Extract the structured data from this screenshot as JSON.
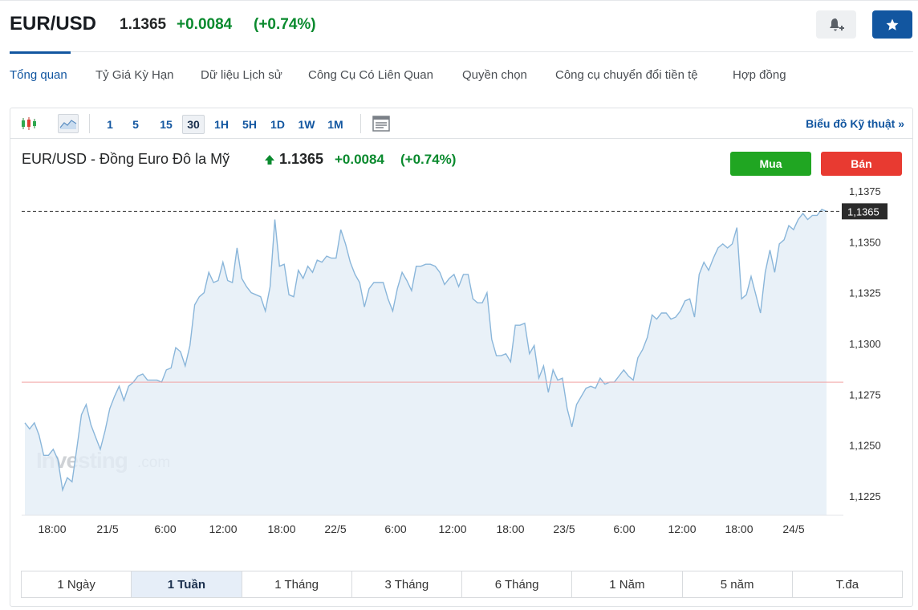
{
  "header": {
    "symbol": "EUR/USD",
    "price": "1.1365",
    "change": "+0.0084",
    "change_pct": "(+0.74%)"
  },
  "tabs": [
    {
      "label": "Tổng quan",
      "active": true
    },
    {
      "label": "Tỷ Giá Kỳ Hạn"
    },
    {
      "label": "Dữ liệu Lịch sử"
    },
    {
      "label": "Công Cụ Có Liên Quan"
    },
    {
      "label": "Quyền chọn"
    },
    {
      "label": "Công cụ chuyển đổi tiền tệ"
    },
    {
      "label": "Hợp đồng"
    }
  ],
  "toolbar": {
    "chart_types": [
      "candlestick-icon",
      "area-chart-icon"
    ],
    "intervals": [
      "1",
      "5",
      "15",
      "30",
      "1H",
      "5H",
      "1D",
      "1W",
      "1M"
    ],
    "selected_interval": "30",
    "technical_link": "Biểu đồ Kỹ thuật »"
  },
  "chart_header": {
    "title": "EUR/USD - Đồng Euro Đô la Mỹ",
    "price": "1.1365",
    "change": "+0.0084",
    "change_pct": "(+0.74%)",
    "buy_label": "Mua",
    "sell_label": "Bán"
  },
  "ranges": [
    "1 Ngày",
    "1 Tuần",
    "1 Tháng",
    "3 Tháng",
    "6 Tháng",
    "1 Năm",
    "5 năm",
    "T.đa"
  ],
  "selected_range": "1 Tuần",
  "watermark": "Investing.com",
  "colors": {
    "accent": "#1256a0",
    "positive": "#0a8a2e",
    "buy": "#20a622",
    "sell": "#e83a31",
    "line": "#8ab6da",
    "area": "#e4edf6",
    "prev_close": "#f2a5a5"
  },
  "chart_data": {
    "type": "area",
    "x_tick_labels": [
      "18:00",
      "21/5",
      "6:00",
      "12:00",
      "18:00",
      "22/5",
      "6:00",
      "12:00",
      "18:00",
      "23/5",
      "6:00",
      "12:00",
      "18:00",
      "24/5"
    ],
    "y_tick_labels": [
      "1,1375",
      "1,1350",
      "1,1325",
      "1,1300",
      "1,1275",
      "1,1250",
      "1,1225"
    ],
    "ylim": [
      1.1218,
      1.138
    ],
    "current_value_label": "1,1365",
    "current_value": 1.1365,
    "previous_close": 1.1281,
    "values": [
      1.1261,
      1.1258,
      1.1261,
      1.1255,
      1.1245,
      1.1245,
      1.1248,
      1.1243,
      1.1228,
      1.1234,
      1.1232,
      1.1248,
      1.1265,
      1.127,
      1.126,
      1.1254,
      1.1248,
      1.1257,
      1.1268,
      1.1274,
      1.1279,
      1.1272,
      1.1279,
      1.1281,
      1.1284,
      1.1285,
      1.1282,
      1.1282,
      1.1282,
      1.1281,
      1.1287,
      1.1288,
      1.1298,
      1.1296,
      1.1289,
      1.1299,
      1.1319,
      1.1323,
      1.1325,
      1.1335,
      1.133,
      1.1331,
      1.134,
      1.1331,
      1.133,
      1.1347,
      1.1332,
      1.1328,
      1.1325,
      1.1324,
      1.1323,
      1.1316,
      1.1328,
      1.1361,
      1.1338,
      1.1339,
      1.1324,
      1.1323,
      1.1336,
      1.1332,
      1.1338,
      1.1335,
      1.1341,
      1.134,
      1.1343,
      1.1342,
      1.1342,
      1.1356,
      1.1349,
      1.134,
      1.1334,
      1.133,
      1.1318,
      1.1327,
      1.133,
      1.133,
      1.133,
      1.1322,
      1.1316,
      1.1327,
      1.1335,
      1.1331,
      1.1326,
      1.1338,
      1.1338,
      1.1339,
      1.1339,
      1.1338,
      1.1335,
      1.1329,
      1.1332,
      1.1334,
      1.1328,
      1.1334,
      1.1334,
      1.1322,
      1.132,
      1.132,
      1.1325,
      1.1302,
      1.1294,
      1.1294,
      1.1295,
      1.1291,
      1.1309,
      1.1309,
      1.131,
      1.1295,
      1.1299,
      1.1283,
      1.1289,
      1.1276,
      1.1287,
      1.1282,
      1.1283,
      1.1268,
      1.1259,
      1.127,
      1.1274,
      1.1278,
      1.1279,
      1.1278,
      1.1283,
      1.128,
      1.1281,
      1.1281,
      1.1284,
      1.1287,
      1.1284,
      1.1282,
      1.1293,
      1.1297,
      1.1303,
      1.1314,
      1.1312,
      1.1315,
      1.1315,
      1.1312,
      1.1313,
      1.1316,
      1.1321,
      1.1322,
      1.1313,
      1.1334,
      1.134,
      1.1336,
      1.1342,
      1.1347,
      1.1349,
      1.1347,
      1.1349,
      1.1357,
      1.1322,
      1.1324,
      1.1333,
      1.1324,
      1.1315,
      1.1335,
      1.1346,
      1.1335,
      1.1349,
      1.1351,
      1.1358,
      1.1356,
      1.1361,
      1.1364,
      1.1361,
      1.1363,
      1.1363,
      1.1366,
      1.1365
    ]
  }
}
